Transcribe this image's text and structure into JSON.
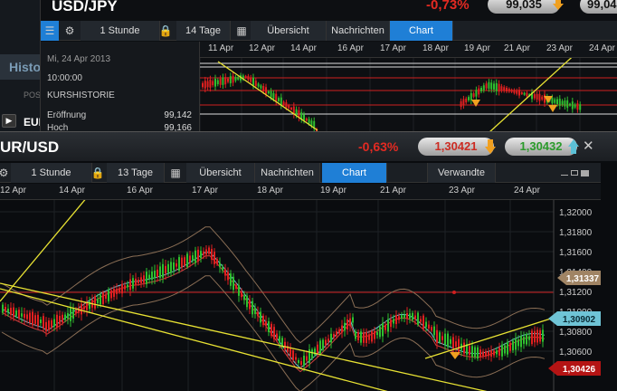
{
  "background_panel": {
    "history_tab": "Histo",
    "pos_label": "POS",
    "eu_label": "EUI"
  },
  "usdjpy": {
    "title": "USD/JPY",
    "change_pct": "-0,73%",
    "bid": "99,035",
    "ask": "99,04",
    "toolbar": {
      "interval": "1 Stunde",
      "range": "14 Tage",
      "tabs": [
        "Übersicht",
        "Nachrichten",
        "Chart"
      ],
      "active_tab": "Chart"
    },
    "info": {
      "date": "Mi, 24 Apr 2013",
      "time": "10:00:00",
      "heading": "KURSHISTORIE",
      "rows": [
        {
          "label": "Eröffnung",
          "value": "99,142"
        },
        {
          "label": "Hoch",
          "value": "99,166"
        }
      ]
    },
    "date_axis": [
      "11 Apr",
      "12 Apr",
      "14 Apr",
      "16 Apr",
      "17 Apr",
      "18 Apr",
      "19 Apr",
      "21 Apr",
      "23 Apr",
      "24 Apr"
    ]
  },
  "eurusd": {
    "title": "UR/USD",
    "change_pct": "-0,63%",
    "bid": "1,30421",
    "ask": "1,30432",
    "close_icon": "close-icon",
    "toolbar": {
      "interval": "1 Stunde",
      "range": "13 Tage",
      "tabs": [
        "Übersicht",
        "Nachrichten",
        "Chart"
      ],
      "active_tab": "Chart",
      "related": "Verwandte"
    },
    "date_axis": [
      "12 Apr",
      "14 Apr",
      "16 Apr",
      "17 Apr",
      "18 Apr",
      "19 Apr",
      "21 Apr",
      "23 Apr",
      "24 Apr"
    ],
    "price_axis": [
      "1,32000",
      "1,31800",
      "1,31600",
      "1,31400",
      "1,31200",
      "1,31000",
      "1,30800",
      "1,30600"
    ],
    "price_markers": [
      {
        "label": "1,31337",
        "color": "#a08464"
      },
      {
        "label": "1,30902",
        "color": "#6fc4d6"
      },
      {
        "label": "1,30426",
        "color": "#b41414"
      }
    ]
  },
  "colors": {
    "accent_blue": "#1f7fd6",
    "negative_red": "#e32a22",
    "ask_green": "#2a9b2a",
    "trendline_yellow": "#e8e233"
  }
}
